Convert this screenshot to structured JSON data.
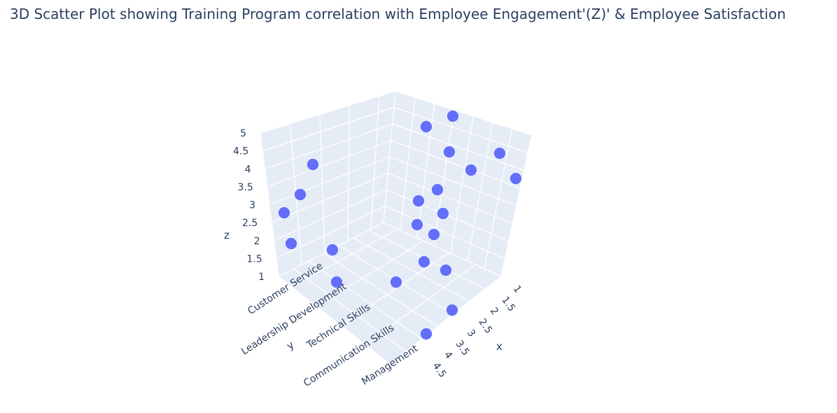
{
  "chart_data": {
    "type": "scatter3d",
    "title": "3D Scatter Plot showing Training Program correlation with Employee Engagement'(Z)' & Employee Satisfaction",
    "xlabel": "x",
    "ylabel": "y",
    "zlabel": "z",
    "x_ticks": [
      "1",
      "1.5",
      "2",
      "2.5",
      "3",
      "3.5",
      "4",
      "4.5"
    ],
    "y_categories": [
      "Customer Service",
      "Leadership Development",
      "Technical Skills",
      "Communication Skills",
      "Management"
    ],
    "z_ticks": [
      "1",
      "1.5",
      "2",
      "2.5",
      "3",
      "3.5",
      "4",
      "4.5",
      "5"
    ],
    "marker_color": "#636efa",
    "grid_color": "#ffffff",
    "scene_bg": "#e5ecf6"
  }
}
